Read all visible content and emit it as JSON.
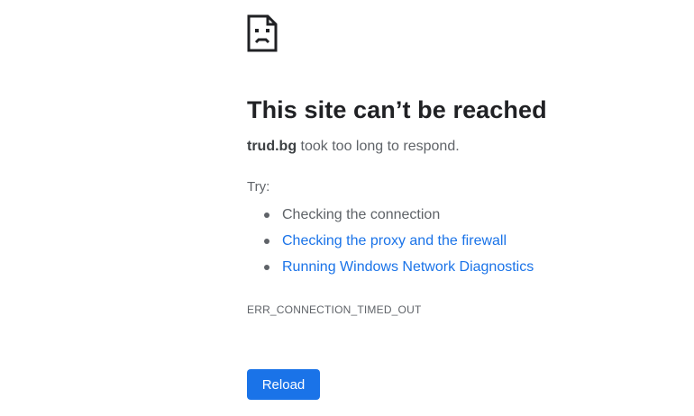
{
  "error_page": {
    "icon": "sad-page-icon",
    "title": "This site can’t be reached",
    "host": "trud.bg",
    "message": " took too long to respond.",
    "try_label": "Try:",
    "suggestions": [
      {
        "label": "Checking the connection",
        "is_link": false
      },
      {
        "label": "Checking the proxy and the firewall",
        "is_link": true
      },
      {
        "label": "Running Windows Network Diagnostics",
        "is_link": true
      }
    ],
    "error_code": "ERR_CONNECTION_TIMED_OUT",
    "reload_label": "Reload"
  },
  "colors": {
    "link": "#1a73e8",
    "button_bg": "#1a73e8",
    "text": "#202124",
    "secondary_text": "#5f6368"
  }
}
